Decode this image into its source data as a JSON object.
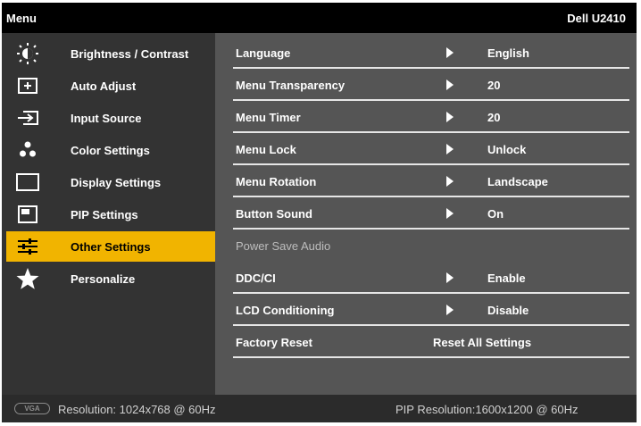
{
  "window": {
    "menu_label": "Menu",
    "model": "Dell U2410"
  },
  "sidebar": {
    "selected_index": 6,
    "accent_color": "#f1b400",
    "items": [
      {
        "label": "Brightness / Contrast",
        "icon": "brightness-icon"
      },
      {
        "label": "Auto Adjust",
        "icon": "auto-adjust-icon"
      },
      {
        "label": "Input Source",
        "icon": "input-source-icon"
      },
      {
        "label": "Color Settings",
        "icon": "color-settings-icon"
      },
      {
        "label": "Display Settings",
        "icon": "display-settings-icon"
      },
      {
        "label": "PIP Settings",
        "icon": "pip-settings-icon"
      },
      {
        "label": "Other Settings",
        "icon": "other-settings-icon"
      },
      {
        "label": "Personalize",
        "icon": "star-icon"
      }
    ]
  },
  "settings": {
    "rows": [
      {
        "name": "Language",
        "value": "English"
      },
      {
        "name": "Menu Transparency",
        "value": "20"
      },
      {
        "name": "Menu Timer",
        "value": "20"
      },
      {
        "name": "Menu Lock",
        "value": "Unlock"
      },
      {
        "name": "Menu Rotation",
        "value": "Landscape"
      },
      {
        "name": "Button Sound",
        "value": "On"
      },
      {
        "name": "Power Save Audio",
        "value": ""
      },
      {
        "name": "DDC/CI",
        "value": "Enable"
      },
      {
        "name": "LCD Conditioning",
        "value": "Disable"
      },
      {
        "name": "Factory Reset",
        "value": "Reset All Settings"
      }
    ]
  },
  "status": {
    "input_icon": "vga-icon",
    "input_icon_text": "VGA",
    "resolution": "Resolution: 1024x768 @ 60Hz",
    "pip_resolution": "PIP Resolution:1600x1200 @ 60Hz"
  }
}
